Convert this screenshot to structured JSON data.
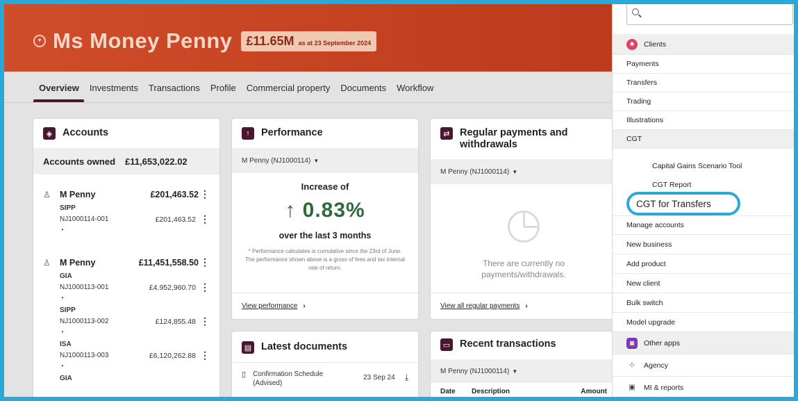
{
  "header": {
    "client_name": "Ms Money Penny",
    "aum_value": "£11.65M",
    "aum_date": "as at 23 September 2024"
  },
  "tabs": [
    "Overview",
    "Investments",
    "Transactions",
    "Profile",
    "Commercial property",
    "Documents",
    "Workflow"
  ],
  "accounts": {
    "title": "Accounts",
    "owned_label": "Accounts owned",
    "owned_total": "£11,653,022.02",
    "owners": [
      {
        "name": "M Penny",
        "amount": "£201,463.52",
        "subaccounts": [
          {
            "type": "SIPP",
            "ref": "NJ1000114-001",
            "amount": "£201,463.52"
          }
        ]
      },
      {
        "name": "M Penny",
        "amount": "£11,451,558.50",
        "subaccounts": [
          {
            "type": "GIA",
            "ref": "NJ1000113-001",
            "amount": "£4,952,960.70"
          },
          {
            "type": "SIPP",
            "ref": "NJ1000113-002",
            "amount": "£124,855.48"
          },
          {
            "type": "ISA",
            "ref": "NJ1000113-003",
            "amount": "£6,120,262.88"
          },
          {
            "type": "GIA",
            "ref": "",
            "amount": ""
          }
        ]
      }
    ]
  },
  "performance": {
    "title": "Performance",
    "selector": "M Penny (NJ1000114)",
    "label": "Increase of",
    "value": "↑ 0.83%",
    "period": "over the last 3 months",
    "note": "* Performance calculates is cumulative since the 23rd of June. The performance shown above is a gross of fees and tax internal rate of return.",
    "link": "View performance"
  },
  "regular_payments": {
    "title": "Regular payments and withdrawals",
    "selector": "M Penny (NJ1000114)",
    "empty": "There are currently no payments/withdrawals.",
    "link": "View all regular payments"
  },
  "latest_documents": {
    "title": "Latest documents",
    "rows": [
      {
        "name": "Confirmation Schedule (Advised)",
        "date": "23 Sep 24"
      }
    ]
  },
  "recent_transactions": {
    "title": "Recent transactions",
    "selector": "M Penny (NJ1000114)",
    "columns": [
      "Date",
      "Description",
      "Amount"
    ]
  },
  "menu": {
    "search_placeholder": "",
    "clients": "Clients",
    "items": [
      "Payments",
      "Transfers",
      "Trading",
      "Illustrations",
      "CGT"
    ],
    "cgt_sub": [
      "Capital Gains Scenario Tool",
      "CGT Report"
    ],
    "highlighted": "CGT for Transfers",
    "items2": [
      "Manage accounts",
      "New business",
      "Add product",
      "New client",
      "Bulk switch",
      "Model upgrade"
    ],
    "other_apps": "Other apps",
    "agency": "Agency",
    "mi_reports": "MI & reports",
    "colors": {
      "clients_icon": "#d9456a",
      "other_apps_icon": "#7b3bb0",
      "highlight_ring": "#2aa8d8",
      "header": "#c2401f",
      "brand": "#4a1730"
    }
  }
}
